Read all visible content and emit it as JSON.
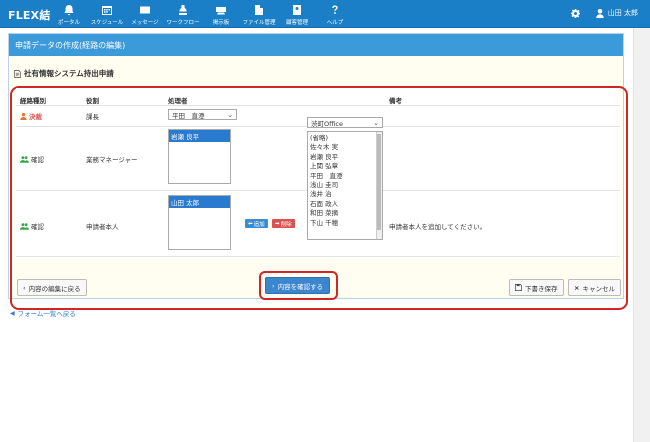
{
  "app": {
    "logo": "FLEX結"
  },
  "nav": [
    {
      "icon": "bell-icon",
      "label": "ポータル"
    },
    {
      "icon": "calendar-icon",
      "label": "スケジュール"
    },
    {
      "icon": "envelope-icon",
      "label": "メッセージ"
    },
    {
      "icon": "workflow-icon",
      "label": "ワークフロー"
    },
    {
      "icon": "board-icon",
      "label": "掲示板"
    },
    {
      "icon": "file-icon",
      "label": "ファイル管理"
    },
    {
      "icon": "contact-icon",
      "label": "顧客管理"
    },
    {
      "icon": "help-icon",
      "label": "ヘルプ"
    }
  ],
  "user": {
    "name": "山田 太郎"
  },
  "panel": {
    "title": "申請データの作成(経路の編集)",
    "form_title": "社有情報システム持出申請"
  },
  "table": {
    "headers": {
      "kind": "経路種別",
      "role": "役割",
      "processor": "処理者",
      "note": "備考"
    },
    "rows": [
      {
        "kind": "決裁",
        "role": "課長",
        "processor": "平田　直澄"
      },
      {
        "kind": "確認",
        "role": "業務マネージャー",
        "processor": "岩瀬 良平"
      },
      {
        "kind": "確認",
        "role": "申請者本人",
        "processor": "山田 太郎",
        "note": "申請者本人を追加してください。"
      }
    ]
  },
  "candidates": {
    "dept": "渋町Office",
    "options": [
      "(省略)",
      "佐々木 実",
      "岩瀬 良平",
      "上関 弘章",
      "平田　直澄",
      "浅山 圭司",
      "浅井 治",
      "石面 政人",
      "和田 菜摘",
      "下山 千穂"
    ]
  },
  "mini": {
    "add": "追加",
    "del": "削除"
  },
  "buttons": {
    "back_edit": "内容の編集に戻る",
    "confirm": "内容を確認する",
    "draft": "下書き保存",
    "cancel": "キャンセル"
  },
  "link": {
    "back_forms": "フォーム一覧へ戻る"
  },
  "colors": {
    "header": "#1a7fc7",
    "panel_head": "#3b9ad9",
    "highlight": "#d22626",
    "primary": "#3b86cf"
  }
}
